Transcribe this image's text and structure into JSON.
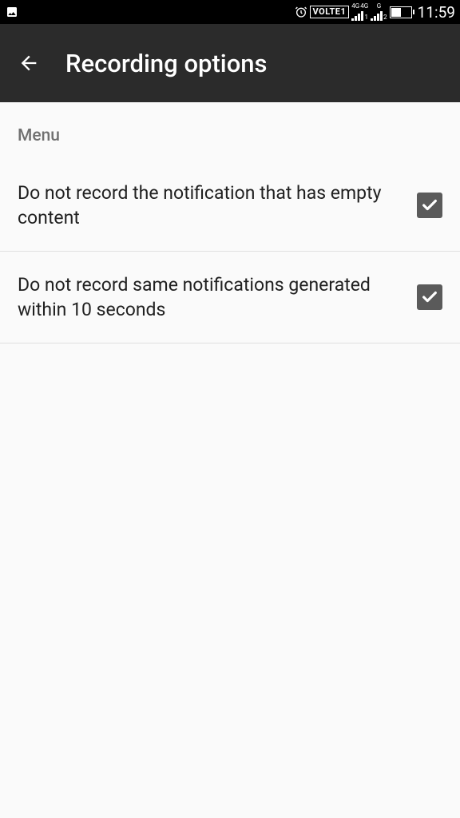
{
  "statusBar": {
    "volte": "VOLTE1",
    "signal1Top": "4G",
    "signal1TopB": "4G",
    "signal1Sub": "1",
    "signal2Top": "G",
    "signal2Sub": "2",
    "time": "11:59"
  },
  "appBar": {
    "title": "Recording options"
  },
  "sectionHeader": "Menu",
  "settings": {
    "item0": {
      "label": "Do not record the notification that has empty content",
      "checked": true
    },
    "item1": {
      "label": "Do not record same notifications generated within 10 seconds",
      "checked": true
    }
  }
}
